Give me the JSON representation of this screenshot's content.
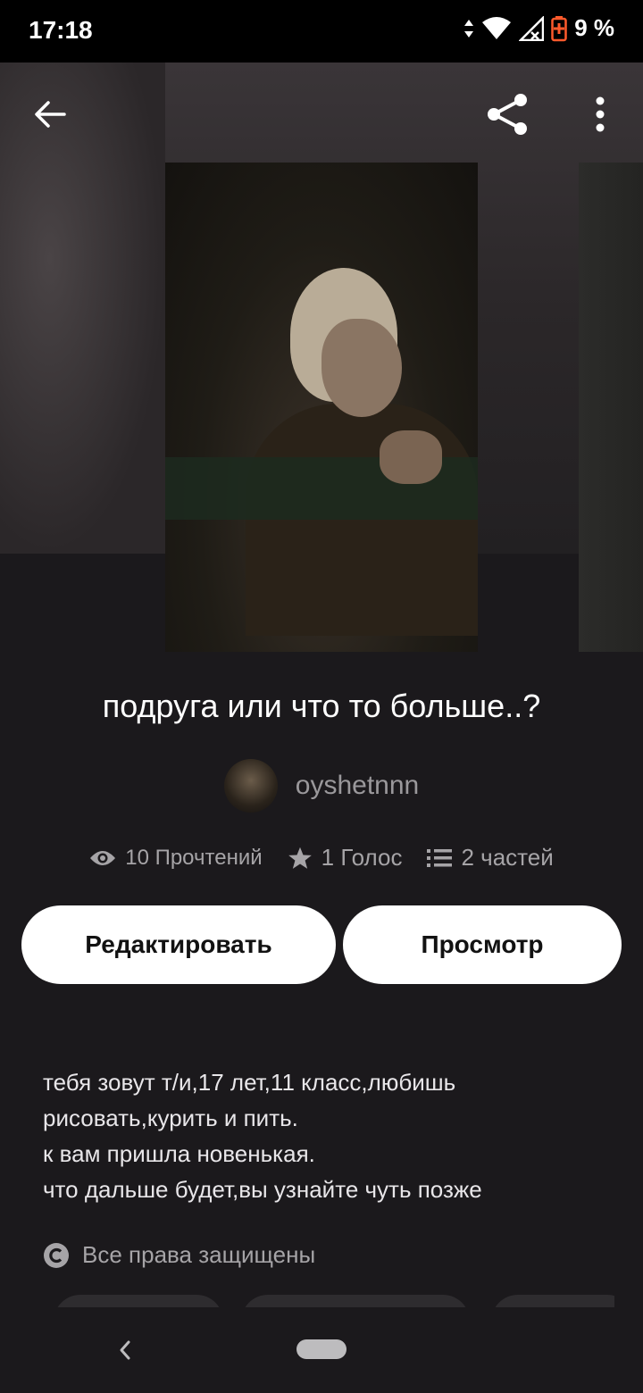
{
  "status_bar": {
    "time": "17:18",
    "battery": "9 %",
    "icons": [
      "data-arrows-icon",
      "wifi-icon",
      "signal-icon",
      "battery-icon"
    ]
  },
  "toolbar": {
    "back_icon": "back-arrow-icon",
    "share_icon": "share-icon",
    "more_icon": "more-vert-icon"
  },
  "story": {
    "title": "подруга или что то больше..?",
    "author": "oyshetnnn",
    "stats": {
      "reads": "10 Прочтений",
      "votes": "1 Голос",
      "parts": "2 частей"
    },
    "description_lines": [
      "тебя зовут т/и,17 лет,11 класс,любишь",
      "рисовать,курить и пить.",
      "к вам пришла новенькая.",
      "что дальше будет,вы узнайте чуть позже"
    ],
    "copyright": "Все права защищены"
  },
  "buttons": {
    "edit": "Редактировать",
    "view": "Просмотр"
  },
  "colors": {
    "background": "#1b191c",
    "button_bg": "#ffffff",
    "muted_text": "#a6a4a7"
  }
}
